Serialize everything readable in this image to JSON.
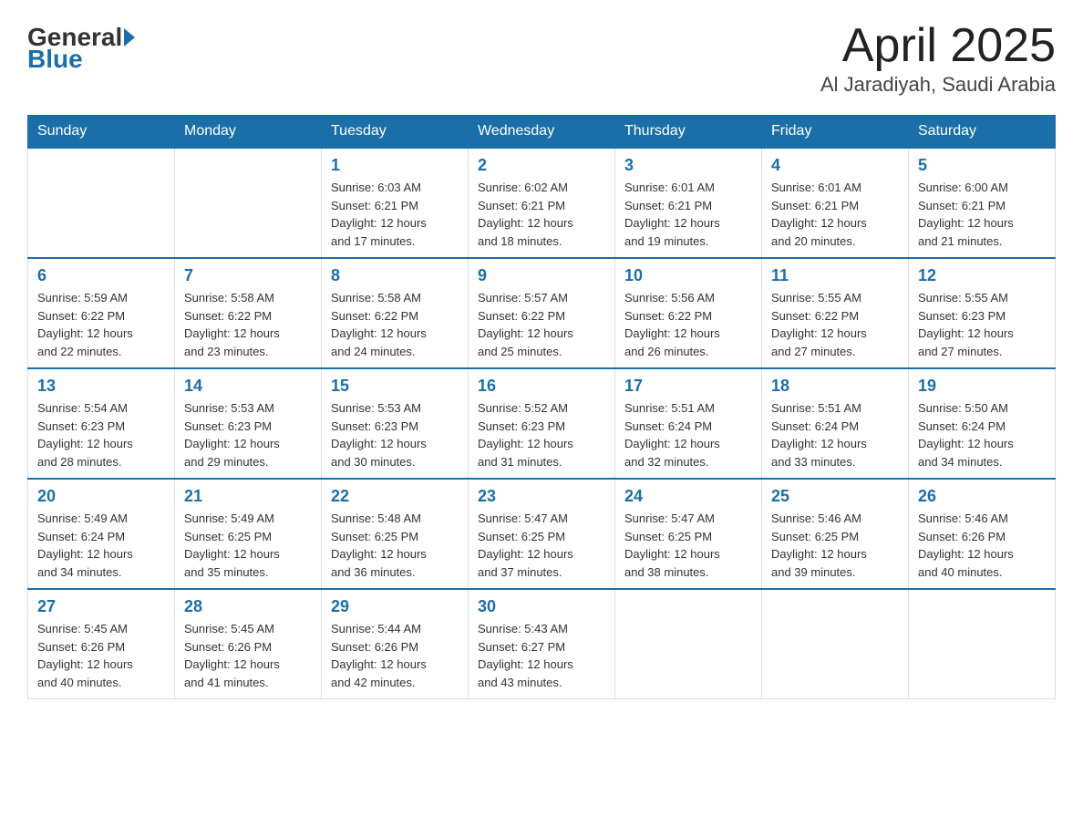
{
  "header": {
    "logo_general": "General",
    "logo_blue": "Blue",
    "title": "April 2025",
    "location": "Al Jaradiyah, Saudi Arabia"
  },
  "days_of_week": [
    "Sunday",
    "Monday",
    "Tuesday",
    "Wednesday",
    "Thursday",
    "Friday",
    "Saturday"
  ],
  "weeks": [
    [
      {
        "day": "",
        "info": ""
      },
      {
        "day": "",
        "info": ""
      },
      {
        "day": "1",
        "info": "Sunrise: 6:03 AM\nSunset: 6:21 PM\nDaylight: 12 hours\nand 17 minutes."
      },
      {
        "day": "2",
        "info": "Sunrise: 6:02 AM\nSunset: 6:21 PM\nDaylight: 12 hours\nand 18 minutes."
      },
      {
        "day": "3",
        "info": "Sunrise: 6:01 AM\nSunset: 6:21 PM\nDaylight: 12 hours\nand 19 minutes."
      },
      {
        "day": "4",
        "info": "Sunrise: 6:01 AM\nSunset: 6:21 PM\nDaylight: 12 hours\nand 20 minutes."
      },
      {
        "day": "5",
        "info": "Sunrise: 6:00 AM\nSunset: 6:21 PM\nDaylight: 12 hours\nand 21 minutes."
      }
    ],
    [
      {
        "day": "6",
        "info": "Sunrise: 5:59 AM\nSunset: 6:22 PM\nDaylight: 12 hours\nand 22 minutes."
      },
      {
        "day": "7",
        "info": "Sunrise: 5:58 AM\nSunset: 6:22 PM\nDaylight: 12 hours\nand 23 minutes."
      },
      {
        "day": "8",
        "info": "Sunrise: 5:58 AM\nSunset: 6:22 PM\nDaylight: 12 hours\nand 24 minutes."
      },
      {
        "day": "9",
        "info": "Sunrise: 5:57 AM\nSunset: 6:22 PM\nDaylight: 12 hours\nand 25 minutes."
      },
      {
        "day": "10",
        "info": "Sunrise: 5:56 AM\nSunset: 6:22 PM\nDaylight: 12 hours\nand 26 minutes."
      },
      {
        "day": "11",
        "info": "Sunrise: 5:55 AM\nSunset: 6:22 PM\nDaylight: 12 hours\nand 27 minutes."
      },
      {
        "day": "12",
        "info": "Sunrise: 5:55 AM\nSunset: 6:23 PM\nDaylight: 12 hours\nand 27 minutes."
      }
    ],
    [
      {
        "day": "13",
        "info": "Sunrise: 5:54 AM\nSunset: 6:23 PM\nDaylight: 12 hours\nand 28 minutes."
      },
      {
        "day": "14",
        "info": "Sunrise: 5:53 AM\nSunset: 6:23 PM\nDaylight: 12 hours\nand 29 minutes."
      },
      {
        "day": "15",
        "info": "Sunrise: 5:53 AM\nSunset: 6:23 PM\nDaylight: 12 hours\nand 30 minutes."
      },
      {
        "day": "16",
        "info": "Sunrise: 5:52 AM\nSunset: 6:23 PM\nDaylight: 12 hours\nand 31 minutes."
      },
      {
        "day": "17",
        "info": "Sunrise: 5:51 AM\nSunset: 6:24 PM\nDaylight: 12 hours\nand 32 minutes."
      },
      {
        "day": "18",
        "info": "Sunrise: 5:51 AM\nSunset: 6:24 PM\nDaylight: 12 hours\nand 33 minutes."
      },
      {
        "day": "19",
        "info": "Sunrise: 5:50 AM\nSunset: 6:24 PM\nDaylight: 12 hours\nand 34 minutes."
      }
    ],
    [
      {
        "day": "20",
        "info": "Sunrise: 5:49 AM\nSunset: 6:24 PM\nDaylight: 12 hours\nand 34 minutes."
      },
      {
        "day": "21",
        "info": "Sunrise: 5:49 AM\nSunset: 6:25 PM\nDaylight: 12 hours\nand 35 minutes."
      },
      {
        "day": "22",
        "info": "Sunrise: 5:48 AM\nSunset: 6:25 PM\nDaylight: 12 hours\nand 36 minutes."
      },
      {
        "day": "23",
        "info": "Sunrise: 5:47 AM\nSunset: 6:25 PM\nDaylight: 12 hours\nand 37 minutes."
      },
      {
        "day": "24",
        "info": "Sunrise: 5:47 AM\nSunset: 6:25 PM\nDaylight: 12 hours\nand 38 minutes."
      },
      {
        "day": "25",
        "info": "Sunrise: 5:46 AM\nSunset: 6:25 PM\nDaylight: 12 hours\nand 39 minutes."
      },
      {
        "day": "26",
        "info": "Sunrise: 5:46 AM\nSunset: 6:26 PM\nDaylight: 12 hours\nand 40 minutes."
      }
    ],
    [
      {
        "day": "27",
        "info": "Sunrise: 5:45 AM\nSunset: 6:26 PM\nDaylight: 12 hours\nand 40 minutes."
      },
      {
        "day": "28",
        "info": "Sunrise: 5:45 AM\nSunset: 6:26 PM\nDaylight: 12 hours\nand 41 minutes."
      },
      {
        "day": "29",
        "info": "Sunrise: 5:44 AM\nSunset: 6:26 PM\nDaylight: 12 hours\nand 42 minutes."
      },
      {
        "day": "30",
        "info": "Sunrise: 5:43 AM\nSunset: 6:27 PM\nDaylight: 12 hours\nand 43 minutes."
      },
      {
        "day": "",
        "info": ""
      },
      {
        "day": "",
        "info": ""
      },
      {
        "day": "",
        "info": ""
      }
    ]
  ],
  "colors": {
    "header_bg": "#1a6fa8",
    "accent": "#1a6fa8"
  }
}
